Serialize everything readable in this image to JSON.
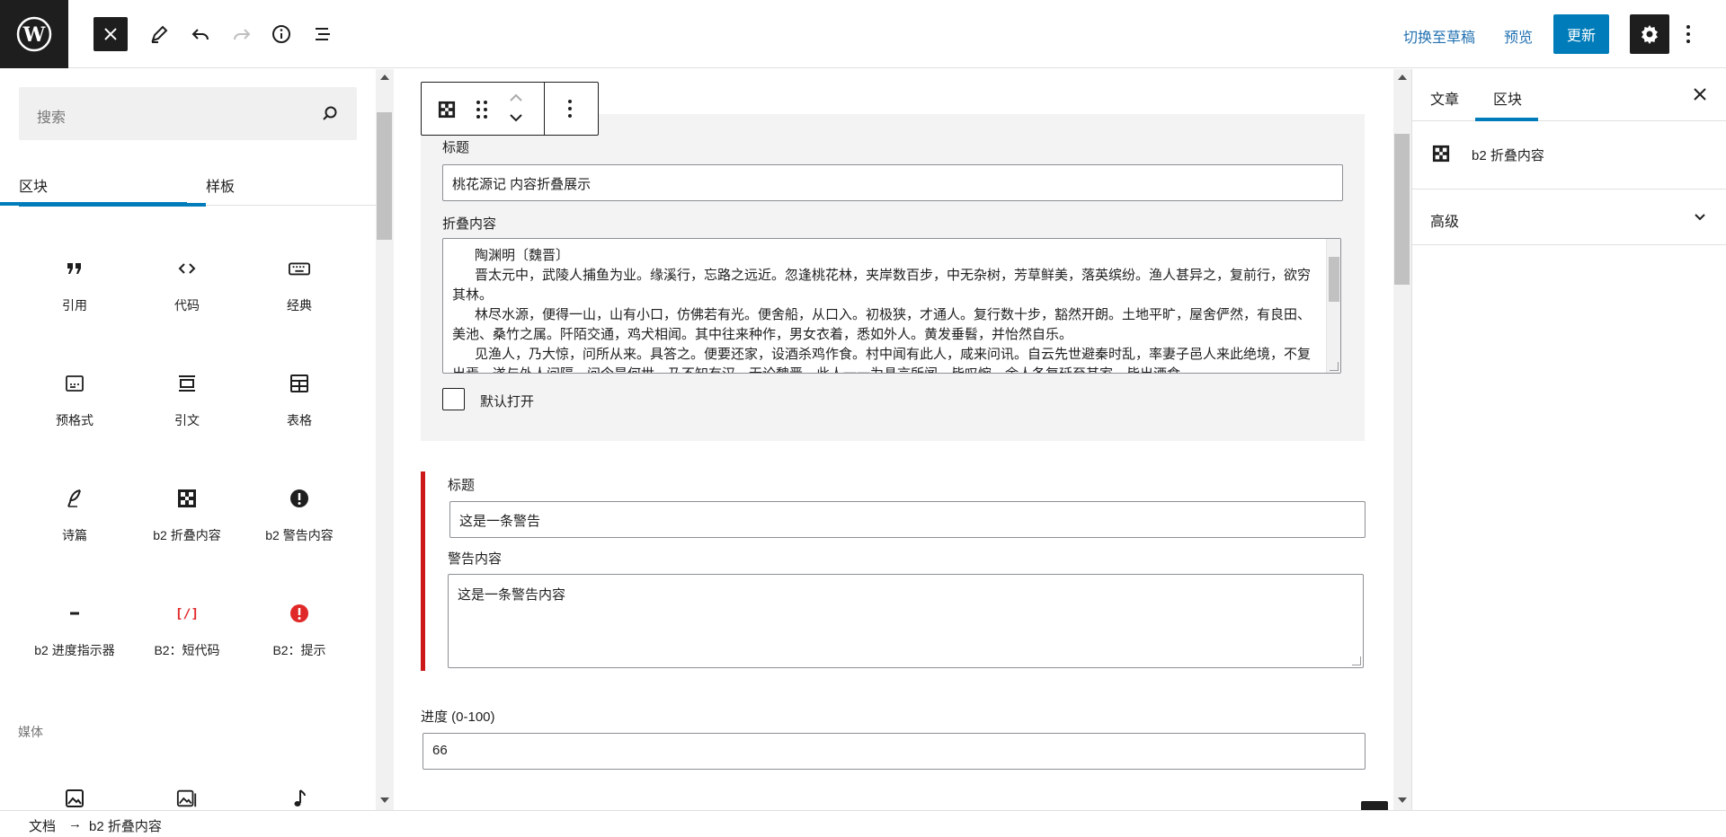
{
  "topbar": {
    "logo": "wordpress-logo",
    "switch_draft": "切换至草稿",
    "preview": "预览",
    "update": "更新"
  },
  "inserter": {
    "search_placeholder": "搜索",
    "tabs": [
      "区块",
      "样板"
    ],
    "blocks": [
      {
        "label": "引用",
        "icon": "quote-icon"
      },
      {
        "label": "代码",
        "icon": "code-icon"
      },
      {
        "label": "经典",
        "icon": "keyboard-icon"
      },
      {
        "label": "预格式",
        "icon": "preformatted-icon"
      },
      {
        "label": "引文",
        "icon": "pullquote-icon"
      },
      {
        "label": "表格",
        "icon": "table-icon"
      },
      {
        "label": "诗篇",
        "icon": "verse-icon"
      },
      {
        "label": "b2 折叠内容",
        "icon": "grid-icon"
      },
      {
        "label": "b2 警告内容",
        "icon": "warning-icon"
      },
      {
        "label": "b2 进度指示器",
        "icon": "minus-icon"
      },
      {
        "label": "B2：短代码",
        "icon": "shortcode-icon"
      },
      {
        "label": "B2：提示",
        "icon": "alert-icon"
      }
    ],
    "category_media": "媒体"
  },
  "editor": {
    "fold": {
      "title_label": "标题",
      "title_value": "桃花源记 内容折叠展示",
      "content_label": "折叠内容",
      "content_value": "      陶渊明〔魏晋〕\n      晋太元中，武陵人捕鱼为业。缘溪行，忘路之远近。忽逢桃花林，夹岸数百步，中无杂树，芳草鲜美，落英缤纷。渔人甚异之，复前行，欲穷其林。\n      林尽水源，便得一山，山有小口，仿佛若有光。便舍船，从口入。初极狭，才通人。复行数十步，豁然开朗。土地平旷，屋舍俨然，有良田、美池、桑竹之属。阡陌交通，鸡犬相闻。其中往来种作，男女衣着，悉如外人。黄发垂髫，并怡然自乐。\n      见渔人，乃大惊，问所从来。具答之。便要还家，设酒杀鸡作食。村中闻有此人，咸来问讯。自云先世避秦时乱，率妻子邑人来此绝境，不复出焉，遂与外人间隔。问今是何世，乃不知有汉，无论魏晋。此人一一为具言所闻，皆叹惋。余人各复延至其家，皆出酒食。",
      "default_open_label": "默认打开"
    },
    "warning": {
      "title_label": "标题",
      "title_value": "这是一条警告",
      "content_label": "警告内容",
      "content_value": "这是一条警告内容"
    },
    "progress": {
      "label": "进度 (0-100)",
      "value": "66"
    }
  },
  "sidebar": {
    "tabs": [
      "文章",
      "区块"
    ],
    "active_tab": "区块",
    "block_name": "b2 折叠内容",
    "advanced": "高级"
  },
  "breadcrumb": [
    "文档",
    "→",
    "b2 折叠内容"
  ],
  "colors": {
    "accent": "#007cba",
    "warning": "#cc1818",
    "dark": "#1e1e1e"
  }
}
